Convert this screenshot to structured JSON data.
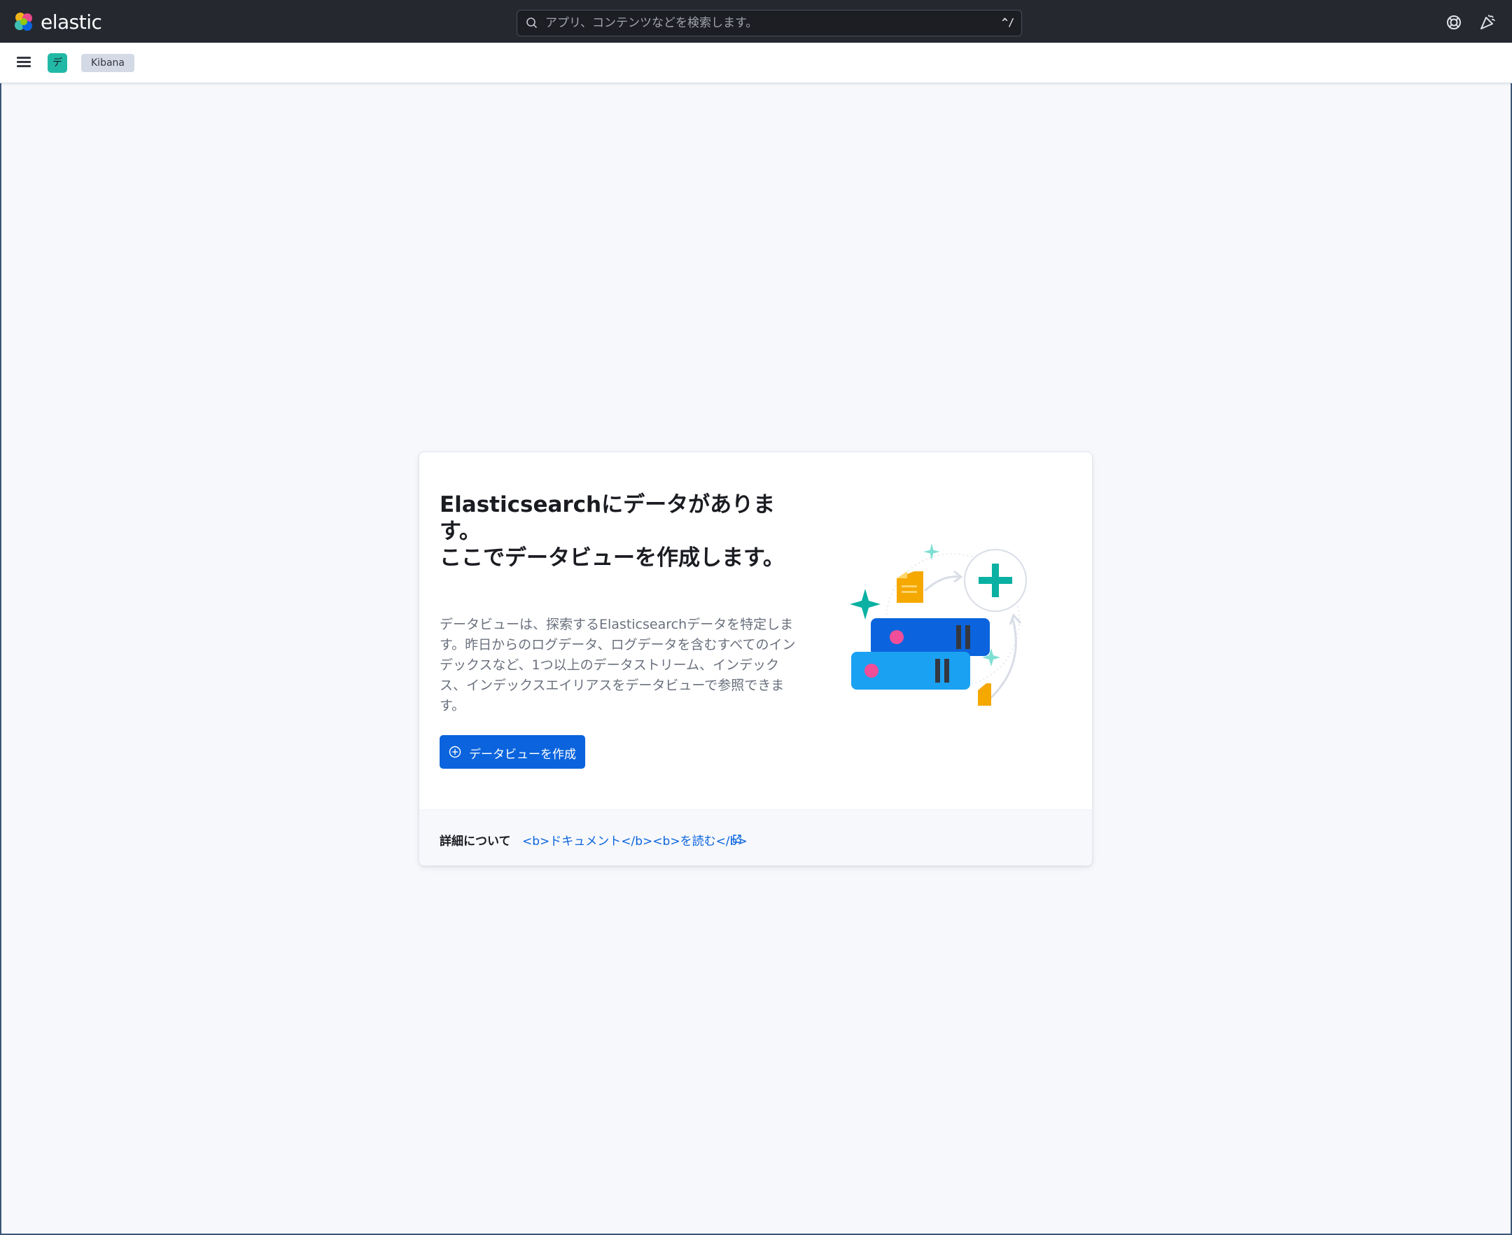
{
  "header": {
    "brand": "elastic",
    "search": {
      "placeholder": "アプリ、コンテンツなどを検索します。",
      "shortcut": "^/"
    }
  },
  "subheader": {
    "space_initial": "デ",
    "breadcrumb": "Kibana"
  },
  "prompt": {
    "title": "Elasticsearchにデータがあります。\nここでデータビューを作成します。",
    "description": "データビューは、探索するElasticsearchデータを特定します。昨日からのログデータ、ログデータを含むすべてのインデックスなど、1つ以上のデータストリーム、インデックス、インデックスエイリアスをデータビューで参照できます。",
    "create_button": "データビューを作成",
    "footer_label": "詳細について",
    "docs_link": "<b>ドキュメント</b><b>を読む</b>"
  },
  "colors": {
    "header_bg": "#25282f",
    "primary": "#0b64dd",
    "space_avatar": "#22b8a6",
    "page_bg": "#f7f8fc"
  },
  "icons": [
    "elastic-logo-icon",
    "search-icon",
    "help-icon",
    "news-icon",
    "hamburger-icon",
    "plus-circle-icon",
    "external-link-icon"
  ]
}
